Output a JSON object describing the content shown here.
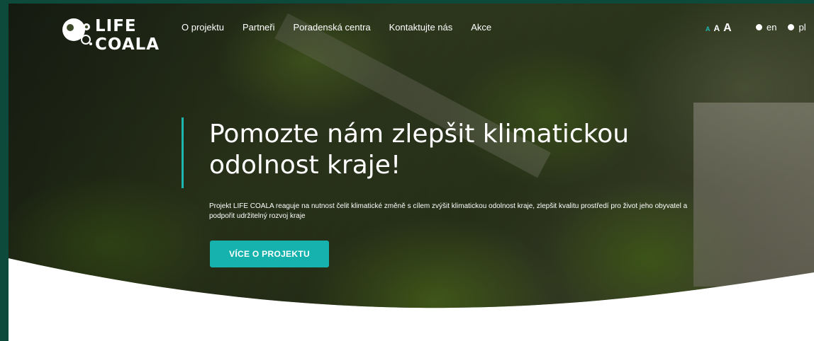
{
  "header": {
    "logo": {
      "line1": "LIFE",
      "line2": "COALA"
    },
    "nav": [
      {
        "label": "O projektu"
      },
      {
        "label": "Partneři"
      },
      {
        "label": "Poradenská centra"
      },
      {
        "label": "Kontaktujte nás"
      },
      {
        "label": "Akce"
      }
    ],
    "font_size_controls": {
      "small": "A",
      "medium": "A",
      "large": "A"
    },
    "languages": [
      {
        "code": "en"
      },
      {
        "code": "pl"
      }
    ]
  },
  "hero": {
    "title": "Pomozte nám zlepšit klimatickou odolnost kraje!",
    "description": "Projekt LIFE COALA reaguje na nutnost čelit klimatické změně s cílem zvýšit klimatickou odolnost kraje, zlepšit kvalitu prostředí pro život jeho obyvatel a podpořit udržitelný rozvoj kraje",
    "cta_label": "VÍCE O PROJEKTU"
  },
  "colors": {
    "accent": "#16b3ae",
    "frame": "#0d4a3c",
    "text_light": "#ffffff"
  }
}
